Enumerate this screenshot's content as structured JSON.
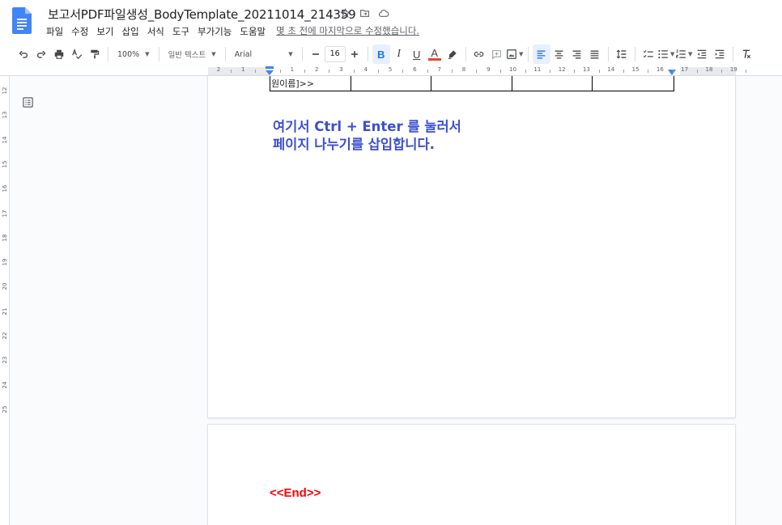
{
  "document": {
    "title": "보고서PDF파일생성_BodyTemplate_20211014_214359"
  },
  "menu": {
    "items": [
      "파일",
      "수정",
      "보기",
      "삽입",
      "서식",
      "도구",
      "부가기능",
      "도움말"
    ],
    "last_edit": "몇 초 전에 마지막으로 수정했습니다."
  },
  "toolbar": {
    "zoom": "100%",
    "style": "일반 텍스트",
    "font": "Arial",
    "font_size": "16",
    "bold_label": "B",
    "italic_label": "I",
    "underline_label": "U",
    "text_color_label": "A",
    "text_color": "#ea4335"
  },
  "ruler": {
    "top_numbers": [
      "2",
      "1",
      "",
      "1",
      "2",
      "3",
      "4",
      "5",
      "6",
      "7",
      "8",
      "9",
      "10",
      "11",
      "12",
      "13",
      "14",
      "15",
      "16",
      "17",
      "18",
      "19"
    ],
    "left_numbers": [
      "12",
      "13",
      "14",
      "15",
      "16",
      "17",
      "18",
      "19",
      "20",
      "21",
      "22",
      "23",
      "24",
      "25"
    ]
  },
  "page1": {
    "table_cell_text": "원이름]>>",
    "instruction_line1": "여기서 Ctrl + Enter 를 눌러서",
    "instruction_line2": "페이지 나누기를 삽입합니다."
  },
  "page2": {
    "end_marker": "<<End>>"
  },
  "colors": {
    "instruction": "#3c4fd0",
    "end_marker": "#ff0000",
    "docs_blue": "#4285f4"
  }
}
